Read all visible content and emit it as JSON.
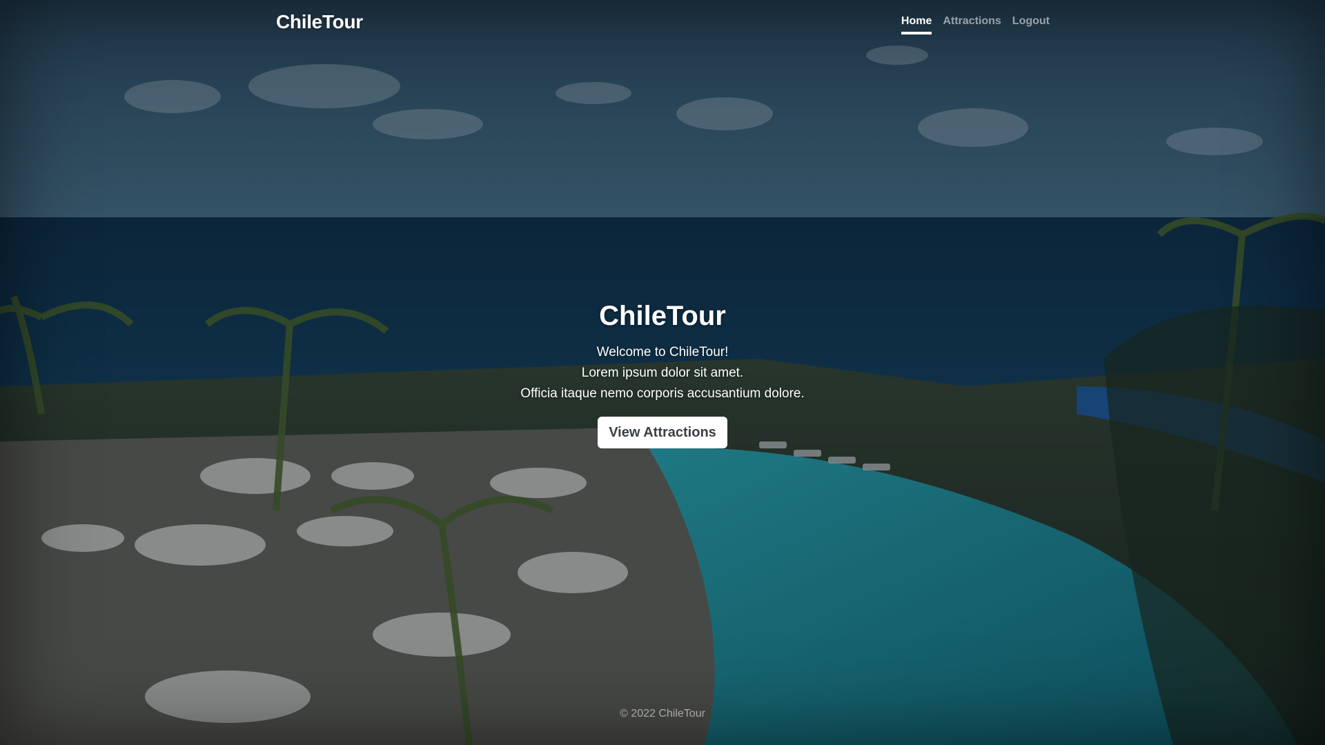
{
  "header": {
    "brand": "ChileTour",
    "nav": [
      {
        "label": "Home",
        "active": true
      },
      {
        "label": "Attractions",
        "active": false
      },
      {
        "label": "Logout",
        "active": false
      }
    ]
  },
  "hero": {
    "title": "ChileTour",
    "lines": [
      "Welcome to ChileTour!",
      "Lorem ipsum dolor sit amet.",
      "Officia itaque nemo corporis accusantium dolore."
    ],
    "cta_label": "View Attractions"
  },
  "footer": {
    "text": "© 2022 ChileTour"
  },
  "background": {
    "description_icon": "resort-photo",
    "sky_color": "#3f6a86",
    "sea_color": "#0f3b5c",
    "pool_color": "#1aa3b0"
  }
}
